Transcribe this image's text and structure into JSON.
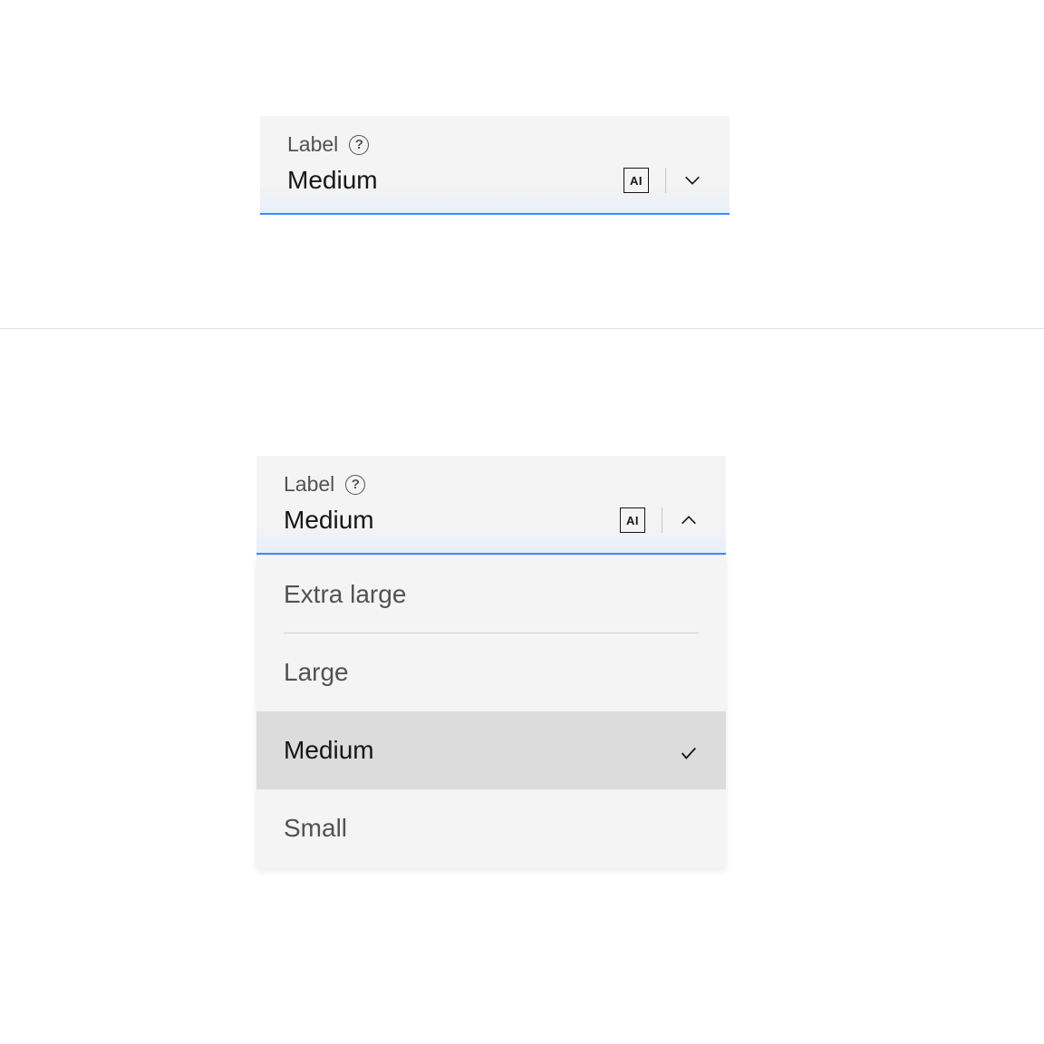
{
  "closed_dropdown": {
    "label": "Label",
    "value": "Medium",
    "ai_badge": "AI",
    "help_icon_char": "?"
  },
  "open_dropdown": {
    "label": "Label",
    "value": "Medium",
    "ai_badge": "AI",
    "help_icon_char": "?",
    "options": [
      {
        "label": "Extra large",
        "selected": false
      },
      {
        "label": "Large",
        "selected": false
      },
      {
        "label": "Medium",
        "selected": true
      },
      {
        "label": "Small",
        "selected": false
      }
    ]
  }
}
